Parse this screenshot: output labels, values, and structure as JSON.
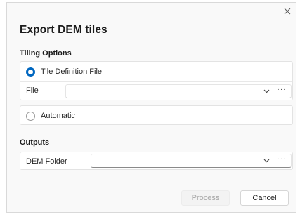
{
  "dialog": {
    "title": "Export DEM tiles",
    "close_icon": "close-icon"
  },
  "tiling": {
    "section_label": "Tiling Options",
    "option_file": {
      "label": "Tile Definition File",
      "selected": true
    },
    "file_field": {
      "label": "File",
      "value": "",
      "more": "···"
    },
    "option_auto": {
      "label": "Automatic",
      "selected": false
    }
  },
  "outputs": {
    "section_label": "Outputs",
    "dem_folder": {
      "label": "DEM Folder",
      "value": "",
      "more": "···"
    }
  },
  "buttons": {
    "process_label": "Process",
    "process_enabled": false,
    "cancel_label": "Cancel"
  },
  "colors": {
    "accent": "#0067c0",
    "background": "#f9f9f9"
  }
}
